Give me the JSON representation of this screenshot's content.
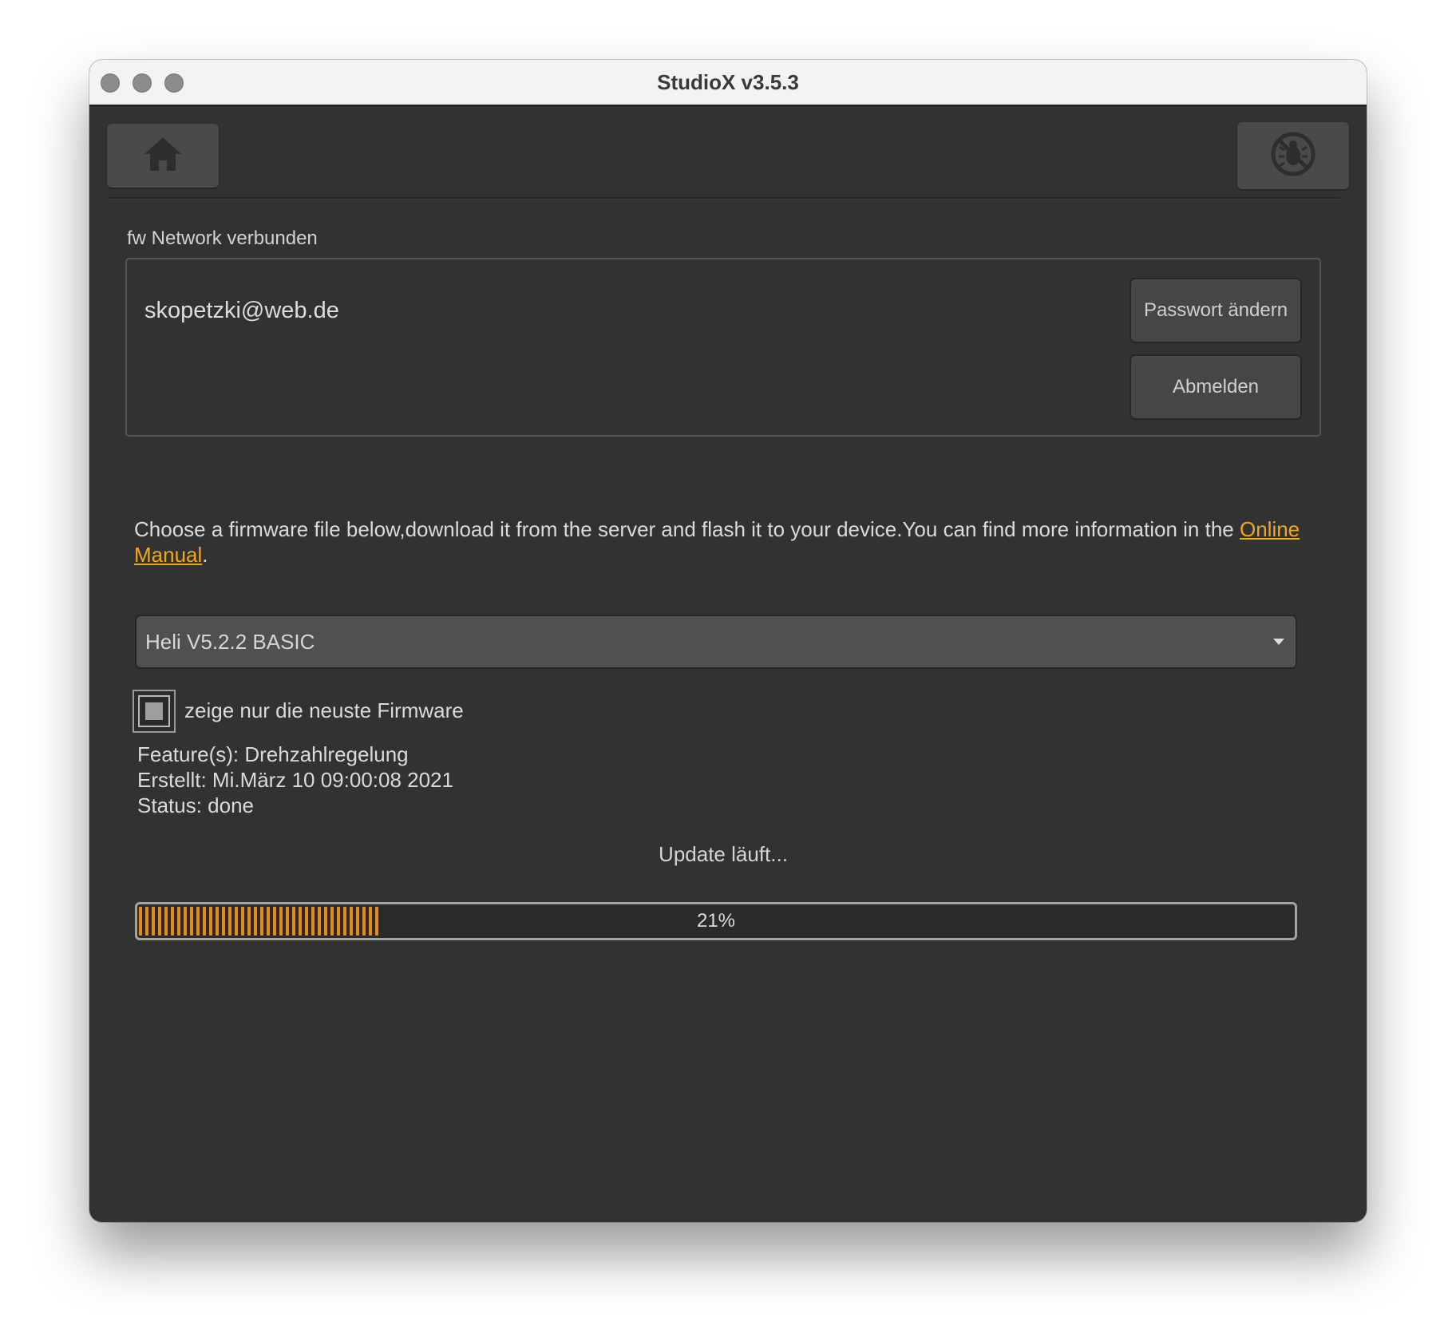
{
  "window": {
    "title": "StudioX v3.5.3"
  },
  "toolbar": {
    "home_icon": "home-icon",
    "disconnect_icon": "no-bug-icon"
  },
  "account": {
    "group_label": "fw Network verbunden",
    "email": "skopetzki@web.de",
    "change_password_label": "Passwort ändern",
    "logout_label": "Abmelden"
  },
  "info": {
    "text": "Choose a firmware file below,download it from the server and flash it to your device.You can find more information in the ",
    "link_text": "Online Manual",
    "suffix": "."
  },
  "firmware_select": {
    "selected": "Heli V5.2.2 BASIC"
  },
  "latest_only": {
    "label": "zeige nur die neuste Firmware",
    "state": "partial"
  },
  "details": {
    "features": "Feature(s): Drehzahlregelung",
    "created": "Erstellt: Mi.März 10 09:00:08 2021",
    "status": "Status: done"
  },
  "update": {
    "status_text": "Update läuft...",
    "progress_label": "21%",
    "progress_value": 0.21,
    "accent_color": "#e88a1a"
  },
  "colors": {
    "background": "#323232",
    "link": "#f0a81a",
    "titlebar": "#f3f3f3"
  }
}
